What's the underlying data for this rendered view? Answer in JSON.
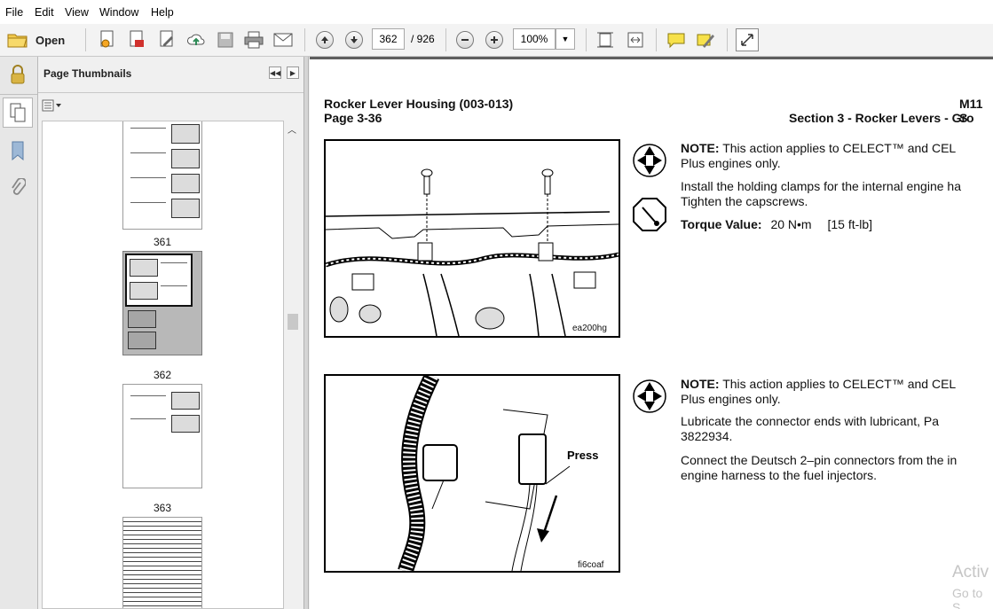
{
  "menu": [
    "File",
    "Edit",
    "View",
    "Window",
    "Help"
  ],
  "toolbar": {
    "open_label": "Open",
    "page_current": "362",
    "page_total": "/ 926",
    "zoom": "100%"
  },
  "panel": {
    "title": "Page Thumbnails",
    "thumbs": [
      {
        "label": "361"
      },
      {
        "label": "362"
      },
      {
        "label": "363"
      }
    ]
  },
  "document": {
    "header_left_title": "Rocker Lever Housing (003-013)",
    "header_left_page": "Page 3-36",
    "header_right_title": "M11 S",
    "header_right_section": "Section 3 - Rocker Levers - Gro",
    "fig1_caption": "ea200hg",
    "fig2_caption": "fi6coaf",
    "fig2_press": "Press",
    "block1": {
      "note_label": "NOTE:",
      "note_text": " This action applies to CELECT™ and CEL",
      "note_text2": "Plus engines only.",
      "install_1": "Install the holding clamps for the internal engine ha",
      "install_2": "Tighten the capscrews.",
      "torque_label": "Torque Value:",
      "torque_value": "20 N•m",
      "torque_alt": "[15 ft-lb]"
    },
    "block2": {
      "note_label": "NOTE:",
      "note_text": " This action applies to CELECT™ and CEL",
      "note_text2": "Plus engines only.",
      "lube_1": "Lubricate the connector ends with lubricant, Pa",
      "lube_2": "3822934.",
      "connect_1": "Connect the Deutsch 2–pin connectors from the in",
      "connect_2": "engine harness to the fuel injectors."
    },
    "watermark_1": "Activ",
    "watermark_2": "Go to S"
  },
  "colors": {
    "accent": "#2f5d9a",
    "doc_border": "#5e5e5e"
  }
}
